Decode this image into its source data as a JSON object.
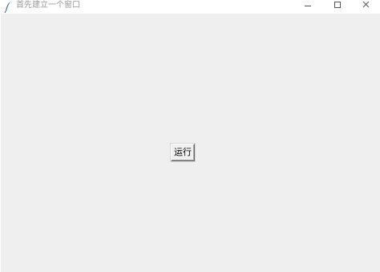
{
  "window": {
    "title": "首先建立一个窗口",
    "icons": {
      "app": "feather-icon",
      "minimize": "minimize-icon",
      "maximize": "maximize-icon",
      "close": "close-icon"
    }
  },
  "main": {
    "run_button_label": "运行"
  },
  "colors": {
    "titlebar_bg": "#ffffff",
    "client_bg": "#efefef",
    "title_text": "#999999"
  }
}
